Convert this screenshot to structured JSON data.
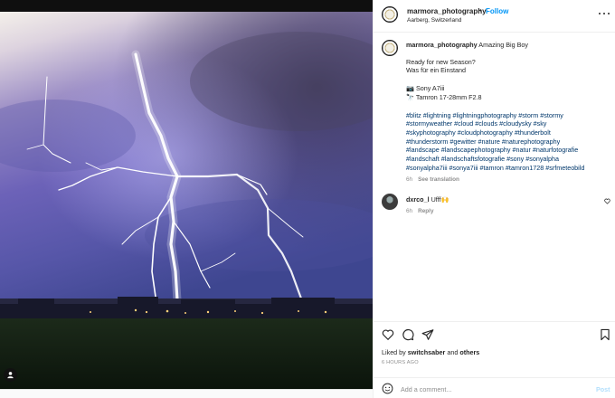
{
  "post": {
    "username": "marmora_photography",
    "dot": "•",
    "follow_label": "Follow",
    "location": "Aarberg, Switzerland",
    "more_icon": "more-horizontal-icon",
    "avatar_icon": "profile-avatar"
  },
  "caption": {
    "username": "marmora_photography",
    "title": "Amazing Big Boy",
    "line1": "Ready for new Season?",
    "line2": "Was für ein Einstand",
    "camera": "📷 Sony A7iii",
    "lens": "🔭 Tamron 17-28mm F2.8",
    "hashtags": [
      "#blitz #lightning #lightningphotography #storm #stormy",
      "#stormyweather #cloud #clouds #cloudysky #sky",
      "#skyphotography #cloudphotography #thunderbolt",
      "#thunderstorm #gewitter #nature #naturephotography",
      "#landscape #landscapephotography #natur #naturfotografie",
      "#landschaft #landschaftsfotografie #sony #sonyalpha",
      "#sonyalpha7iii #sonya7iii #tamron #tamron1728 #srfmeteobild"
    ],
    "age": "6h",
    "see_translation": "See translation"
  },
  "comment": {
    "username": "dxrco_l",
    "text": "Ufff🙌",
    "age": "6h",
    "reply": "Reply"
  },
  "actions": {
    "icons": [
      "heart-icon",
      "comment-icon",
      "share-icon",
      "bookmark-icon"
    ]
  },
  "likes": {
    "prefix": "Liked by",
    "user": "switchsaber",
    "and": "and",
    "others": "others"
  },
  "timestamp": "6 HOURS AGO",
  "add_comment": {
    "placeholder": "Add a comment...",
    "post_label": "Post"
  },
  "colors": {
    "link": "#0095f6",
    "hashtag": "#00376b",
    "muted": "#8e8e8e"
  }
}
